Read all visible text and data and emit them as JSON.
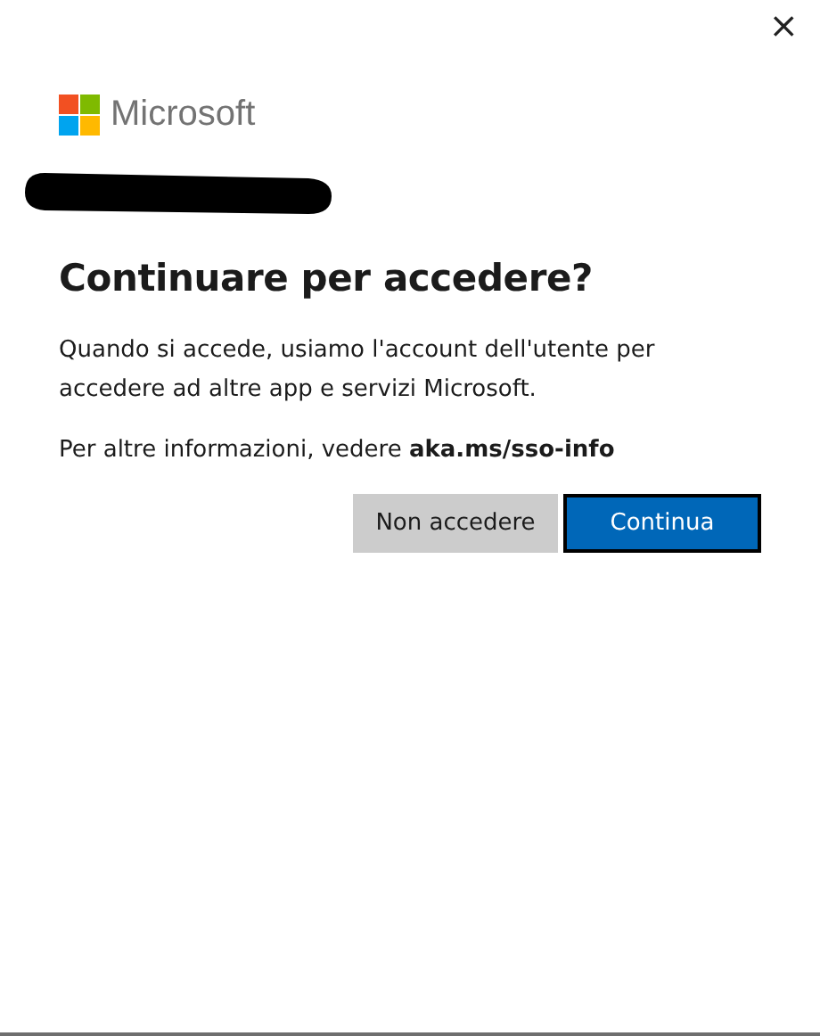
{
  "close": "×",
  "brand": {
    "name": "Microsoft"
  },
  "redacted_account": true,
  "title": "Continuare per accedere?",
  "paragraphs": [
    "Quando si accede, usiamo l'account dell'utente per accedere ad altre app e servizi Microsoft.",
    "Per altre informazioni, vedere **aka.ms/sso-info**"
  ],
  "buttons": [
    {
      "label": "Non accedere",
      "kind": "secondary"
    },
    {
      "label": "Continua",
      "kind": "primary"
    }
  ]
}
